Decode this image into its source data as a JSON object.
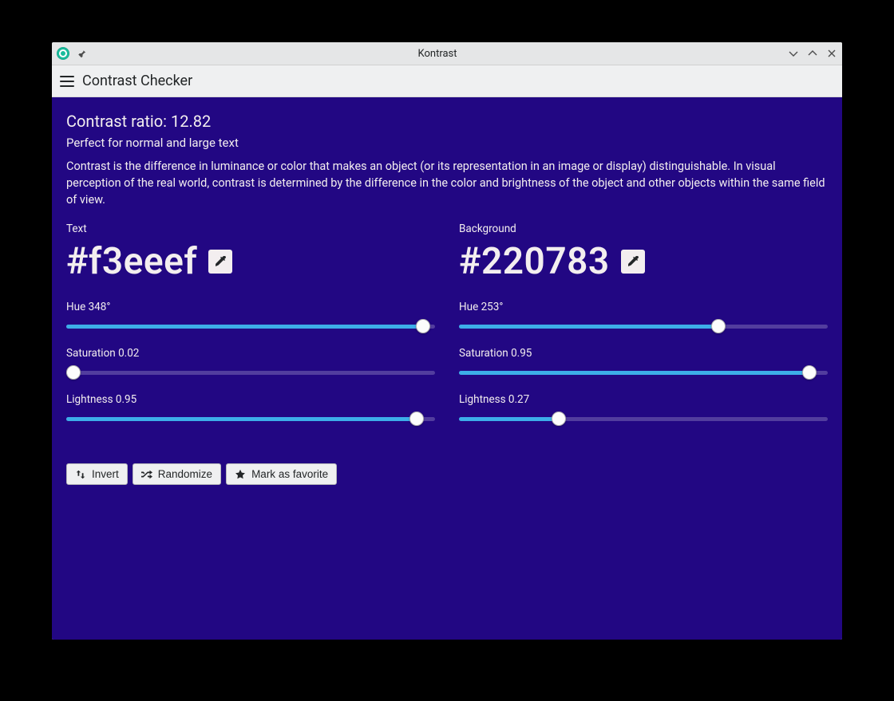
{
  "window": {
    "title": "Kontrast"
  },
  "toolbar": {
    "title": "Contrast Checker"
  },
  "ratio": {
    "label": "Contrast ratio: ",
    "value": "12.82"
  },
  "verdict": "Perfect for normal and large text",
  "description": "Contrast is the difference in luminance or color that makes an object (or its representation in an image or display) distinguishable. In visual perception of the real world, contrast is determined by the difference in the color and brightness of the object and other objects within the same field of view.",
  "text_color": {
    "label": "Text",
    "value": "#f3eeef",
    "hue": {
      "label": "Hue 348°",
      "pct": 96.7
    },
    "saturation": {
      "label": "Saturation 0.02",
      "pct": 2
    },
    "lightness": {
      "label": "Lightness 0.95",
      "pct": 95
    }
  },
  "bg_color": {
    "label": "Background",
    "value": "#220783",
    "hue": {
      "label": "Hue 253°",
      "pct": 70.3
    },
    "saturation": {
      "label": "Saturation 0.95",
      "pct": 95
    },
    "lightness": {
      "label": "Lightness 0.27",
      "pct": 27
    }
  },
  "actions": {
    "invert": "Invert",
    "randomize": "Randomize",
    "favorite": "Mark as favorite"
  }
}
